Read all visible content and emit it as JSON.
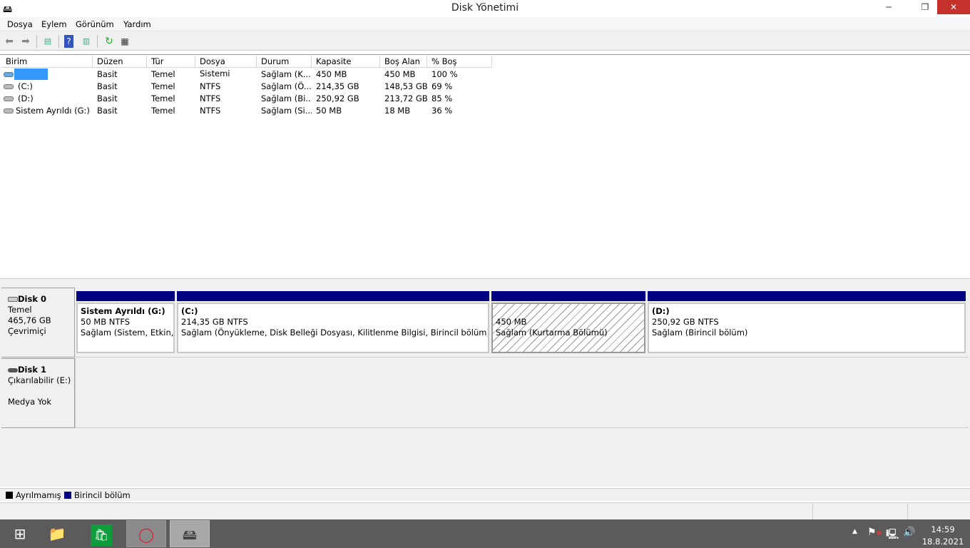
{
  "window": {
    "title": "Disk Yönetimi",
    "minimize": "─",
    "restore": "❐",
    "close": "✕"
  },
  "menu": [
    "Dosya",
    "Eylem",
    "Görünüm",
    "Yardım"
  ],
  "toolbar": {
    "back": "back-icon",
    "forward": "forward-icon",
    "console_tree": "show-hide-console-tree-icon",
    "help": "help-icon",
    "action_pane": "show-hide-action-pane-icon",
    "refresh": "refresh-icon",
    "properties": "properties-icon"
  },
  "columns": [
    "Birim",
    "Düzen",
    "Tür",
    "Dosya Sistemi",
    "Durum",
    "Kapasite",
    "Boş Alan",
    "% Boş"
  ],
  "rows": [
    [
      "",
      "Basit",
      "Temel",
      "",
      "Sağlam (K...",
      "450 MB",
      "450 MB",
      "100 %"
    ],
    [
      "(C:)",
      "Basit",
      "Temel",
      "NTFS",
      "Sağlam (Ö...",
      "214,35 GB",
      "148,53 GB",
      "69 %"
    ],
    [
      "(D:)",
      "Basit",
      "Temel",
      "NTFS",
      "Sağlam (Bi...",
      "250,92 GB",
      "213,72 GB",
      "85 %"
    ],
    [
      "Sistem Ayrıldı (G:)",
      "Basit",
      "Temel",
      "NTFS",
      "Sağlam (Si...",
      "50 MB",
      "18 MB",
      "36 %"
    ]
  ],
  "disks": [
    {
      "name": "Disk 0",
      "type": "Temel",
      "size": "465,76 GB",
      "status": "Çevrimiçi",
      "partitions": [
        {
          "title": "Sistem Ayrıldı  (G:)",
          "size": "50 MB NTFS",
          "status": "Sağlam (Sistem, Etkin, B"
        },
        {
          "title": " (C:)",
          "size": "214,35 GB NTFS",
          "status": "Sağlam (Önyükleme, Disk Belleği Dosyası, Kilitlenme Bilgisi, Birincil bölüm)"
        },
        {
          "title": "",
          "size": "450 MB",
          "status": "Sağlam (Kurtarma Bölümü)"
        },
        {
          "title": " (D:)",
          "size": "250,92 GB NTFS",
          "status": "Sağlam (Birincil bölüm)"
        }
      ]
    },
    {
      "name": "Disk 1",
      "type": "Çıkarılabilir (E:)",
      "media": "Medya Yok"
    }
  ],
  "legend": [
    {
      "label": "Ayrılmamış",
      "color": "#000000"
    },
    {
      "label": "Birincil bölüm",
      "color": "#000080"
    }
  ],
  "taskbar": {
    "time": "14:59",
    "date": "18.8.2021"
  }
}
